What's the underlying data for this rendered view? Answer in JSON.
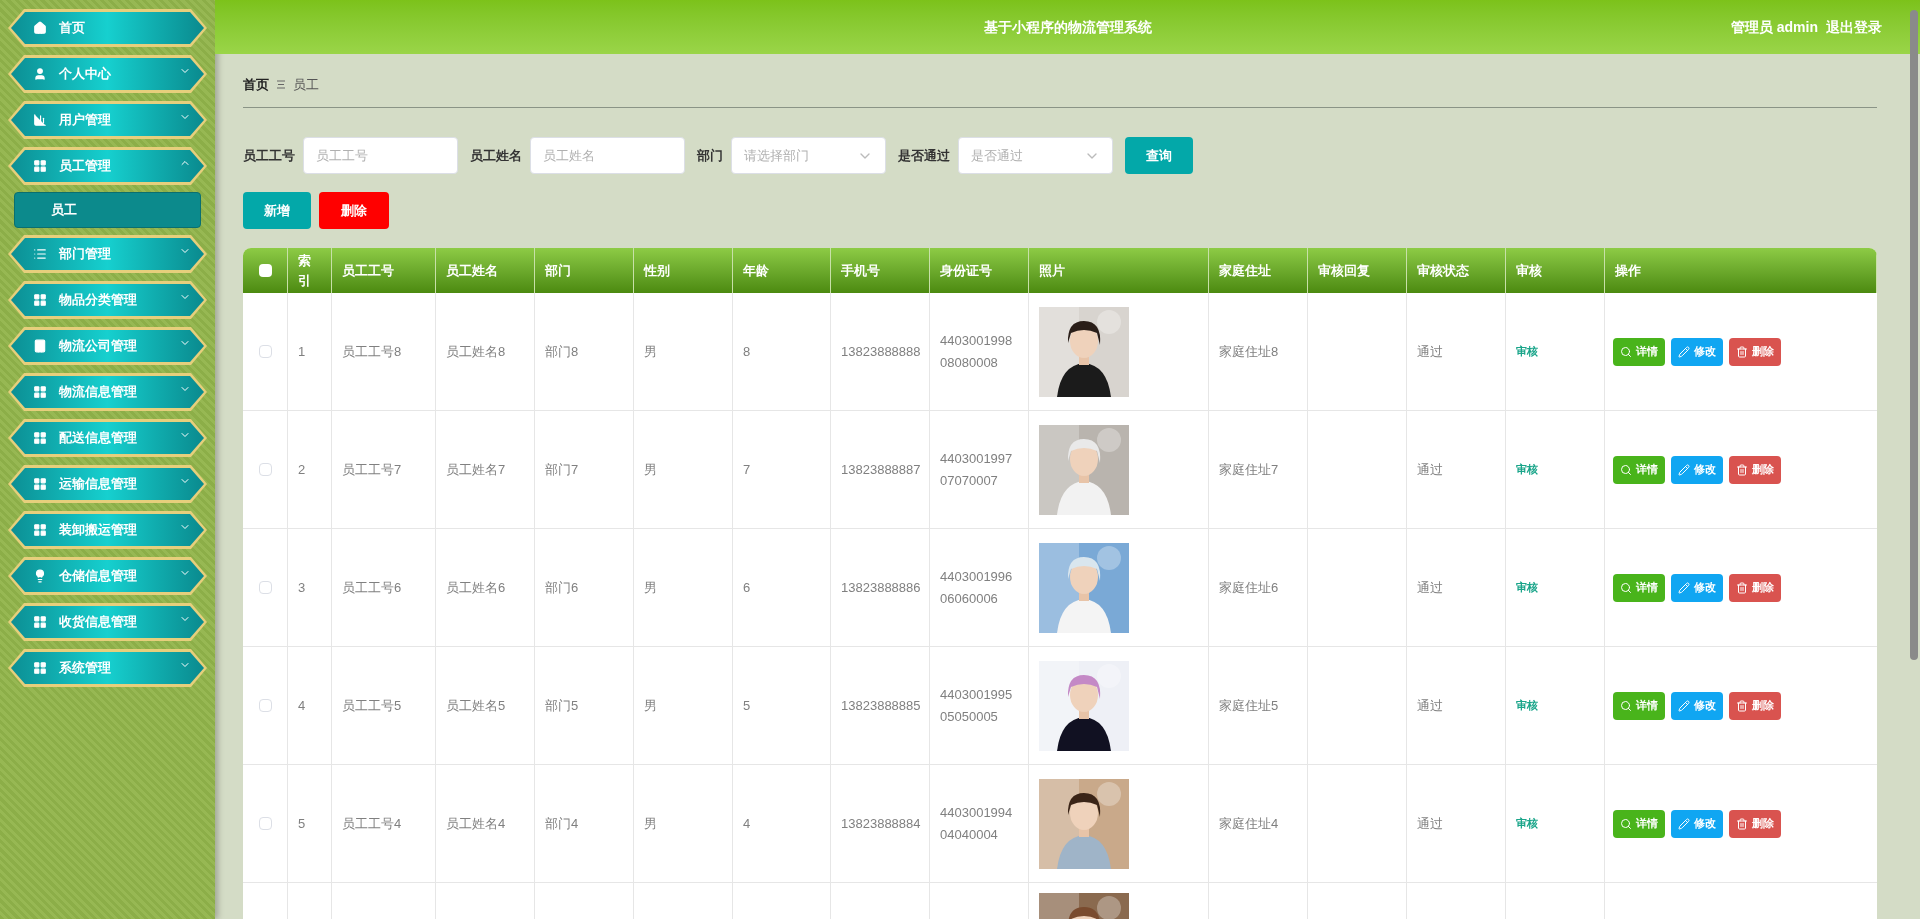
{
  "sidebar": {
    "items": [
      {
        "label": "首页",
        "kind": "link"
      },
      {
        "label": "个人中心",
        "kind": "menu",
        "expanded": false
      },
      {
        "label": "用户管理",
        "kind": "menu",
        "expanded": false
      },
      {
        "label": "员工管理",
        "kind": "menu",
        "expanded": true,
        "children": [
          {
            "label": "员工",
            "selected": true
          }
        ]
      },
      {
        "label": "部门管理",
        "kind": "menu",
        "expanded": false
      },
      {
        "label": "物品分类管理",
        "kind": "menu",
        "expanded": false
      },
      {
        "label": "物流公司管理",
        "kind": "menu",
        "expanded": false
      },
      {
        "label": "物流信息管理",
        "kind": "menu",
        "expanded": false
      },
      {
        "label": "配送信息管理",
        "kind": "menu",
        "expanded": false
      },
      {
        "label": "运输信息管理",
        "kind": "menu",
        "expanded": false
      },
      {
        "label": "装卸搬运管理",
        "kind": "menu",
        "expanded": false
      },
      {
        "label": "仓储信息管理",
        "kind": "menu",
        "expanded": false
      },
      {
        "label": "收货信息管理",
        "kind": "menu",
        "expanded": false
      },
      {
        "label": "系统管理",
        "kind": "menu",
        "expanded": false
      }
    ]
  },
  "header": {
    "title": "基于小程序的物流管理系统",
    "user": "管理员 admin",
    "logout": "退出登录"
  },
  "breadcrumb": [
    "首页",
    "员工"
  ],
  "search": {
    "fields": [
      {
        "label": "员工工号",
        "placeholder": "员工工号",
        "kind": "input"
      },
      {
        "label": "员工姓名",
        "placeholder": "员工姓名",
        "kind": "input"
      },
      {
        "label": "部门",
        "placeholder": "请选择部门",
        "kind": "select"
      },
      {
        "label": "是否通过",
        "placeholder": "是否通过",
        "kind": "select"
      }
    ],
    "button": "查询"
  },
  "toolbar": {
    "add": "新增",
    "delete": "删除"
  },
  "table": {
    "select_all": {
      "checked": false
    },
    "columns": [
      "索引",
      "员工工号",
      "员工姓名",
      "部门",
      "性别",
      "年龄",
      "手机号",
      "身份证号",
      "照片",
      "家庭住址",
      "审核回复",
      "审核状态",
      "审核",
      "操作"
    ],
    "rows": [
      {
        "checked": false,
        "cells": [
          "1",
          "员工工号8",
          "员工姓名8",
          "部门8",
          "男",
          "8",
          "13823888888",
          "440300199808080008"
        ],
        "photo": {
          "kind": "picture"
        },
        "address": "家庭住址8",
        "status": "通过",
        "audit": "审核",
        "actions": [
          "详情",
          "修改",
          "删除"
        ]
      },
      {
        "checked": false,
        "cells": [
          "2",
          "员工工号7",
          "员工姓名7",
          "部门7",
          "男",
          "7",
          "13823888887",
          "440300199707070007"
        ],
        "photo": {
          "kind": "picture"
        },
        "address": "家庭住址7",
        "status": "通过",
        "audit": "审核",
        "actions": [
          "详情",
          "修改",
          "删除"
        ]
      },
      {
        "checked": false,
        "cells": [
          "3",
          "员工工号6",
          "员工姓名6",
          "部门6",
          "男",
          "6",
          "13823888886",
          "440300199606060006"
        ],
        "photo": {
          "kind": "picture"
        },
        "address": "家庭住址6",
        "status": "通过",
        "audit": "审核",
        "actions": [
          "详情",
          "修改",
          "删除"
        ]
      },
      {
        "checked": false,
        "cells": [
          "4",
          "员工工号5",
          "员工姓名5",
          "部门5",
          "男",
          "5",
          "13823888885",
          "440300199505050005"
        ],
        "photo": {
          "kind": "picture"
        },
        "address": "家庭住址5",
        "status": "通过",
        "audit": "审核",
        "actions": [
          "详情",
          "修改",
          "删除"
        ]
      },
      {
        "checked": false,
        "cells": [
          "5",
          "员工工号4",
          "员工姓名4",
          "部门4",
          "男",
          "4",
          "13823888884",
          "440300199404040004"
        ],
        "photo": {
          "kind": "picture"
        },
        "address": "家庭住址4",
        "status": "通过",
        "audit": "审核",
        "actions": [
          "详情",
          "修改",
          "删除"
        ]
      },
      {
        "photo": {
          "kind": "picture"
        }
      }
    ]
  }
}
